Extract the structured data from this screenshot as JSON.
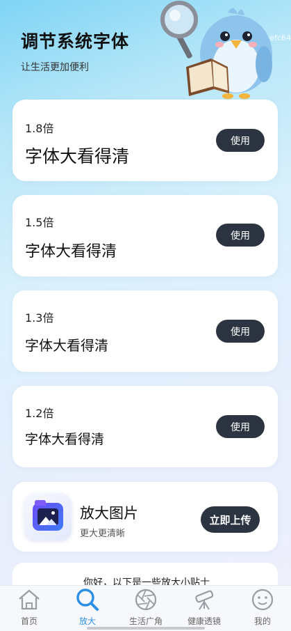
{
  "header": {
    "title": "调节系统字体",
    "subtitle": "让生活更加便利",
    "id_tag": "ID:eefc64"
  },
  "font_options": [
    {
      "scale": "1.8倍",
      "sample": "字体大看得清",
      "button": "使用"
    },
    {
      "scale": "1.5倍",
      "sample": "字体大看得清",
      "button": "使用"
    },
    {
      "scale": "1.3倍",
      "sample": "字体大看得清",
      "button": "使用"
    },
    {
      "scale": "1.2倍",
      "sample": "字体大看得清",
      "button": "使用"
    }
  ],
  "magnify_feature": {
    "title": "放大图片",
    "subtitle": "更大更清晰",
    "button": "立即上传",
    "icon": "image-app-icon"
  },
  "tip": {
    "text": "你好，以下是一些放大小贴士"
  },
  "nav": {
    "items": [
      {
        "label": "首页",
        "icon": "home-icon",
        "active": false
      },
      {
        "label": "放大",
        "icon": "magnifier-icon",
        "active": true
      },
      {
        "label": "生活广角",
        "icon": "aperture-icon",
        "active": false
      },
      {
        "label": "健康透镜",
        "icon": "telescope-icon",
        "active": false
      },
      {
        "label": "我的",
        "icon": "smiley-icon",
        "active": false
      }
    ]
  },
  "colors": {
    "accent": "#2b8fe6",
    "button_dark": "#2c3441",
    "background_top": "#7fd4f5",
    "background_bottom": "#eef0fb"
  }
}
